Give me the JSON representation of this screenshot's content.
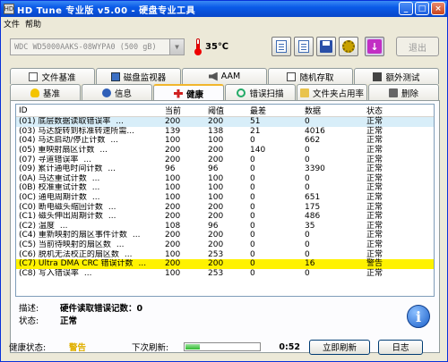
{
  "window": {
    "title": "HD Tune 专业版 v5.00 - 硬盘专业工具",
    "app_icon": "HD"
  },
  "menu": [
    "文件",
    "帮助"
  ],
  "toolbar": {
    "drive": "WDC WD5000AAKS-08WYPA0 (500 gB)",
    "temperature": "35℃",
    "exit_label": "退出",
    "icons": [
      "copy-icon",
      "copy-icon",
      "save-icon",
      "settings-icon",
      "download-icon"
    ]
  },
  "tabs_row1": [
    {
      "label": "文件基准",
      "icon": "file-icon"
    },
    {
      "label": "磁盘监视器",
      "icon": "monitor-icon"
    },
    {
      "label": "AAM",
      "icon": "speaker-icon"
    },
    {
      "label": "随机存取",
      "icon": "checkbox-icon"
    },
    {
      "label": "额外测试",
      "icon": "grid-icon"
    }
  ],
  "tabs_row2": [
    {
      "label": "基准",
      "icon": "bulb-icon"
    },
    {
      "label": "信息",
      "icon": "info-icon"
    },
    {
      "label": "健康",
      "icon": "health-cross-icon",
      "active": true
    },
    {
      "label": "错误扫描",
      "icon": "magnifier-icon"
    },
    {
      "label": "文件夹占用率",
      "icon": "folder-icon"
    },
    {
      "label": "删除",
      "icon": "trash-icon"
    }
  ],
  "table": {
    "headers": [
      "ID",
      "当前",
      "阈值",
      "最差",
      "数据",
      "状态"
    ],
    "rows": [
      {
        "id": "(01) 底层数据读取错误率",
        "dots": "...",
        "current": "200",
        "threshold": "200",
        "worst": "51",
        "data": "0",
        "status": "正常",
        "selected": true
      },
      {
        "id": "(03) 马达旋转到标准转速所需...",
        "dots": "",
        "current": "139",
        "threshold": "138",
        "worst": "21",
        "data": "4016",
        "status": "正常"
      },
      {
        "id": "(04) 马达启动/停止计数",
        "dots": "...",
        "current": "100",
        "threshold": "100",
        "worst": "0",
        "data": "662",
        "status": "正常"
      },
      {
        "id": "(05) 重映射扇区计数",
        "dots": "...",
        "current": "200",
        "threshold": "200",
        "worst": "140",
        "data": "0",
        "status": "正常"
      },
      {
        "id": "(07) 寻道错误率",
        "dots": "...",
        "current": "200",
        "threshold": "200",
        "worst": "0",
        "data": "0",
        "status": "正常"
      },
      {
        "id": "(09) 累计通电时间计数",
        "dots": "...",
        "current": "96",
        "threshold": "96",
        "worst": "0",
        "data": "3390",
        "status": "正常"
      },
      {
        "id": "(0A) 马达重试计数",
        "dots": "...",
        "current": "100",
        "threshold": "100",
        "worst": "0",
        "data": "0",
        "status": "正常"
      },
      {
        "id": "(0B) 校准重试计数",
        "dots": "...",
        "current": "100",
        "threshold": "100",
        "worst": "0",
        "data": "0",
        "status": "正常"
      },
      {
        "id": "(0C) 通电周期计数",
        "dots": "...",
        "current": "100",
        "threshold": "100",
        "worst": "0",
        "data": "651",
        "status": "正常"
      },
      {
        "id": "(C0) 断电磁头缩回计数",
        "dots": "...",
        "current": "200",
        "threshold": "200",
        "worst": "0",
        "data": "175",
        "status": "正常"
      },
      {
        "id": "(C1) 磁头伸出周期计数",
        "dots": "...",
        "current": "200",
        "threshold": "200",
        "worst": "0",
        "data": "486",
        "status": "正常"
      },
      {
        "id": "(C2) 温度",
        "dots": "...",
        "current": "108",
        "threshold": "96",
        "worst": "0",
        "data": "35",
        "status": "正常"
      },
      {
        "id": "(C4) 重新映射的扇区事件计数",
        "dots": "...",
        "current": "200",
        "threshold": "200",
        "worst": "0",
        "data": "0",
        "status": "正常"
      },
      {
        "id": "(C5) 当前待映射的扇区数",
        "dots": "...",
        "current": "200",
        "threshold": "200",
        "worst": "0",
        "data": "0",
        "status": "正常"
      },
      {
        "id": "(C6) 脱机无法校正的扇区数",
        "dots": "...",
        "current": "100",
        "threshold": "253",
        "worst": "0",
        "data": "0",
        "status": "正常"
      },
      {
        "id": "(C7) Ultra DMA CRC 错误计数",
        "dots": "...",
        "current": "200",
        "threshold": "200",
        "worst": "0",
        "data": "16",
        "status": "警告",
        "warning": true
      },
      {
        "id": "(C8) 写入错误率",
        "dots": "...",
        "current": "100",
        "threshold": "253",
        "worst": "0",
        "data": "0",
        "status": "正常"
      }
    ]
  },
  "details": {
    "desc_label": "描述:",
    "desc_value": "硬件读取错误记数：0",
    "status_label": "状态:",
    "status_value": "正常"
  },
  "statusbar": {
    "health_label": "健康状态:",
    "health_value": "警告",
    "next_refresh_label": "下次刷新:",
    "countdown": "0:52",
    "refresh_progress": 0.2,
    "refresh_button": "立即刷新",
    "log_button": "日志"
  }
}
